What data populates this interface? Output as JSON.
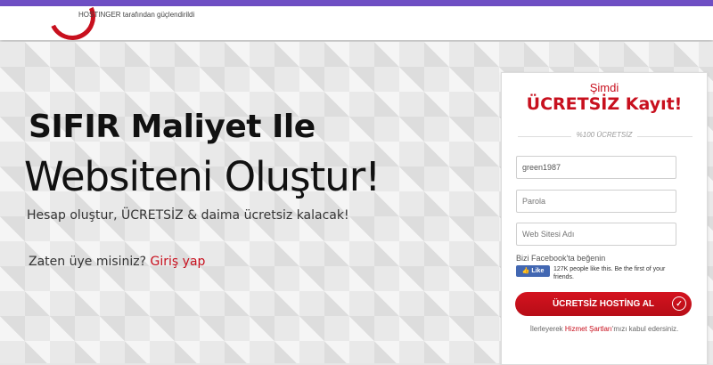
{
  "header": {
    "powered_by": "HOSTINGER tarafından güçlendirildi"
  },
  "hero": {
    "headline_bold": "SIFIR Maliyet Ile",
    "headline_light": "Websiteni Oluştur!",
    "subtext": "Hesap oluştur, ÜCRETSİZ & daima ücretsiz kalacak!",
    "member_question": "Zaten üye misiniz?",
    "login_link": "Giriş yap"
  },
  "signup": {
    "now_label": "Şimdi",
    "title": "ÜCRETSİZ Kayıt!",
    "divider_label": "%100 ÜCRETSİZ",
    "username_value": "green1987",
    "password_placeholder": "Parola",
    "website_placeholder": "Web Sitesi Adı",
    "facebook_label": "Bizi Facebook'ta beğenin",
    "facebook_like_button": "Like",
    "facebook_like_text": "127K people like this. Be the first of your friends.",
    "cta_label": "ÜCRETSİZ HOSTİNG AL",
    "terms_prefix": "İlerleyerek",
    "terms_link": "Hizmet Şartları",
    "terms_suffix": "'mızı kabul edersiniz."
  },
  "colors": {
    "accent": "#c8101e",
    "topbar": "#6f4fc4",
    "facebook": "#4267b2"
  }
}
